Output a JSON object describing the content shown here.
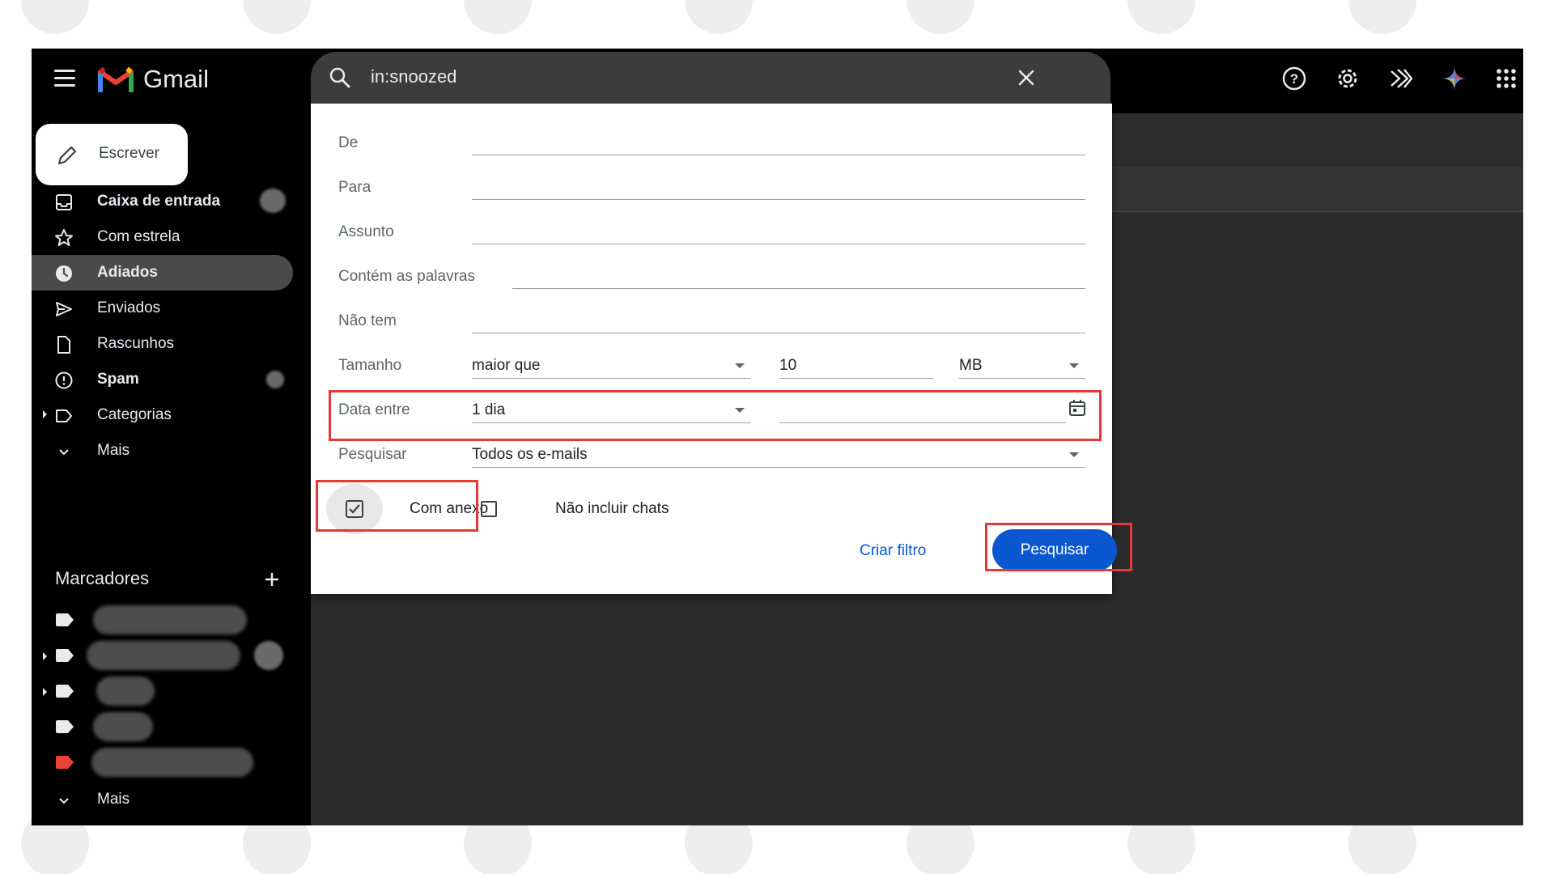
{
  "app": {
    "name": "Gmail"
  },
  "search": {
    "query": "in:snoozed"
  },
  "compose": {
    "label": "Escrever"
  },
  "sidebar": {
    "items": [
      {
        "label": "Caixa de entrada",
        "icon": "inbox-icon",
        "bold": true
      },
      {
        "label": "Com estrela",
        "icon": "star-icon"
      },
      {
        "label": "Adiados",
        "icon": "clock-icon",
        "active": true,
        "bold": true
      },
      {
        "label": "Enviados",
        "icon": "send-icon"
      },
      {
        "label": "Rascunhos",
        "icon": "draft-icon"
      },
      {
        "label": "Spam",
        "icon": "spam-icon",
        "bold": true
      },
      {
        "label": "Categorias",
        "icon": "label-outline-icon"
      },
      {
        "label": "Mais",
        "icon": "chevron-down-icon"
      }
    ],
    "labels_title": "Marcadores",
    "labels_more": "Mais"
  },
  "dialog": {
    "from_label": "De",
    "to_label": "Para",
    "subject_label": "Assunto",
    "has_words_label": "Contém as palavras",
    "doesnt_have_label": "Não tem",
    "size_label": "Tamanho",
    "size_operator": "maior que",
    "size_value": "10",
    "size_unit": "MB",
    "date_label": "Data entre",
    "date_range": "1 dia",
    "search_in_label": "Pesquisar",
    "search_in_value": "Todos os e-mails",
    "has_attachment_label": "Com anexo",
    "has_attachment_checked": true,
    "exclude_chats_label": "Não incluir chats",
    "exclude_chats_checked": false,
    "create_filter_label": "Criar filtro",
    "search_button_label": "Pesquisar"
  },
  "colors": {
    "accent": "#0b57d0",
    "highlight": "#e53935",
    "label_red": "#ea4335"
  }
}
